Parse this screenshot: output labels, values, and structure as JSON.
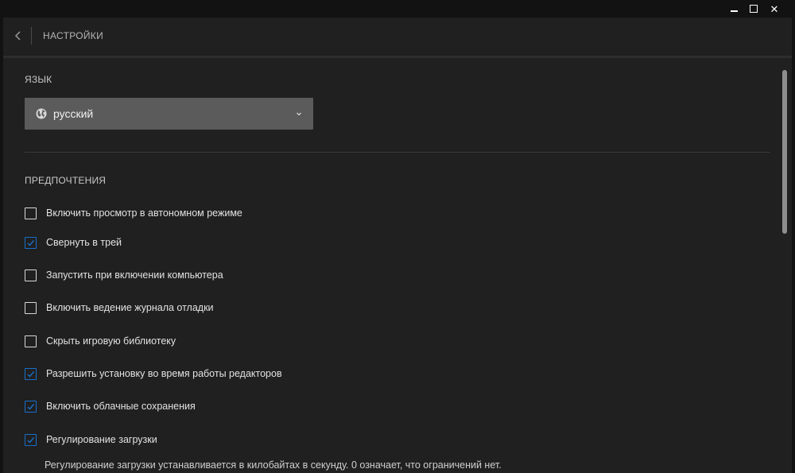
{
  "window_controls": {
    "minimize_icon": "minimize-icon",
    "maximize_icon": "maximize-icon",
    "close_icon": "close-icon",
    "close_glyph": "✕"
  },
  "header": {
    "title": "НАСТРОЙКИ",
    "back_icon": "chevron-left-icon"
  },
  "language": {
    "section_title": "ЯЗЫК",
    "selected": "русский",
    "icon": "globe-icon",
    "caret_icon": "chevron-down-icon"
  },
  "preferences": {
    "section_title": "ПРЕДПОЧТЕНИЯ",
    "items": [
      {
        "label": "Включить просмотр в автономном режиме",
        "checked": false
      },
      {
        "label": "Свернуть в трей",
        "checked": true
      },
      {
        "label": "Запустить при включении компьютера",
        "checked": false
      },
      {
        "label": "Включить ведение журнала отладки",
        "checked": false
      },
      {
        "label": "Скрыть игровую библиотеку",
        "checked": false
      },
      {
        "label": "Разрешить установку во время работы редакторов",
        "checked": true
      },
      {
        "label": "Включить облачные сохранения",
        "checked": true
      },
      {
        "label": "Регулирование загрузки",
        "checked": true
      }
    ],
    "throttle_note": "Регулирование загрузки устанавливается в килобайтах в секунду. 0 означает, что ограничений нет."
  },
  "colors": {
    "background": "#202020",
    "titlebar": "#121212",
    "select_bg": "#5b5b5b",
    "accent": "#1a6fc9",
    "scrollbar": "#8e8e8e"
  }
}
